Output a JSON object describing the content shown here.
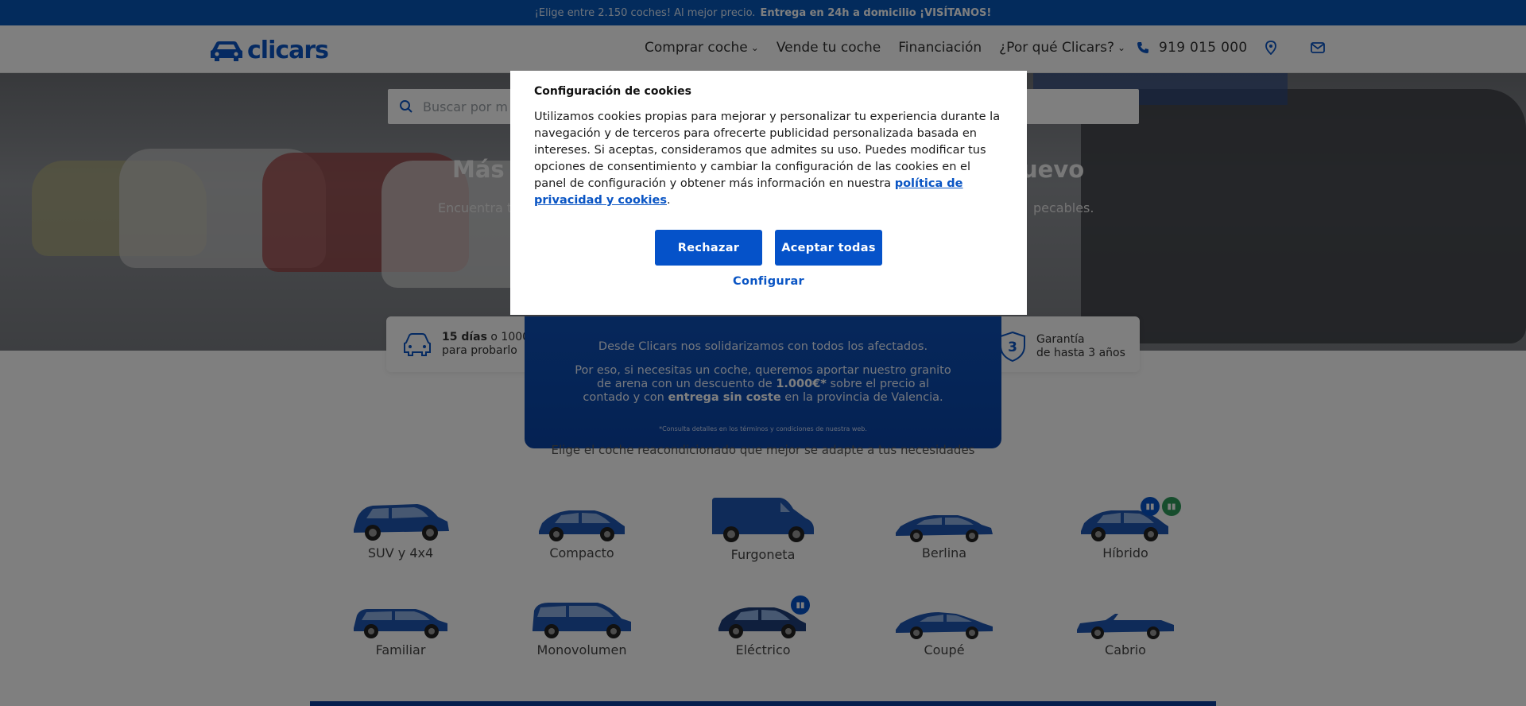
{
  "promo": {
    "text": "¡Elige entre 2.150 coches! Al mejor precio.",
    "highlight": "Entrega en 24h a domicilio ¡VISÍTANOS!"
  },
  "header": {
    "logo_text": "clicars",
    "nav": [
      {
        "label": "Comprar coche",
        "has_dropdown": true
      },
      {
        "label": "Vende tu coche",
        "has_dropdown": false
      },
      {
        "label": "Financiación",
        "has_dropdown": false
      },
      {
        "label": "¿Por qué Clicars?",
        "has_dropdown": true
      }
    ],
    "phone": "919 015 000",
    "icons": [
      "phone-icon",
      "location-pin-icon",
      "mail-icon"
    ]
  },
  "hero": {
    "search_placeholder": "Buscar por m",
    "title_left": "Más g",
    "title_right": "uevo",
    "subtitle_left": "Encuentra t",
    "subtitle_right": "pecables."
  },
  "benefits": [
    {
      "line1_bold": "15 días",
      "line1_rest": " o 1000",
      "line2": "para probarlo",
      "icon": "car-front-icon"
    },
    {
      "line1_bold": "",
      "line1_rest": "Garantía",
      "line2": "de hasta 3 años",
      "icon": "shield-3-icon"
    }
  ],
  "solidarity": {
    "line1": "Desde Clicars nos solidarizamos con todos los afectados.",
    "line2_a": "Por eso, si necesitas un coche, queremos aportar nuestro granito de arena con un descuento de ",
    "line2_bold1": "1.000€*",
    "line2_b": " sobre el precio al contado y con ",
    "line2_bold2": "entrega sin coste",
    "line2_c": " en la provincia de Valencia.",
    "footnote": "*Consulta detalles en los términos y condiciones de nuestra web."
  },
  "section_subtitle": "Elige el coche reacondicionado que mejor se adapte a tus necesidades",
  "categories": [
    {
      "label": "SUV y 4x4"
    },
    {
      "label": "Compacto"
    },
    {
      "label": "Furgoneta"
    },
    {
      "label": "Berlina"
    },
    {
      "label": "Híbrido"
    },
    {
      "label": "Familiar"
    },
    {
      "label": "Monovolumen"
    },
    {
      "label": "Eléctrico"
    },
    {
      "label": "Coupé"
    },
    {
      "label": "Cabrio"
    }
  ],
  "colors": {
    "brand_blue": "#0552c9",
    "promo_blue": "#0757b8",
    "car_blue": "#1f56b3"
  },
  "cookie_modal": {
    "title": "Configuración de cookies",
    "body": "Utilizamos cookies propias para mejorar y personalizar tu experiencia durante la navegación y de terceros para ofrecerte publicidad personalizada basada en intereses. Si aceptas, consideramos que admites su uso. Puedes modificar tus opciones de consentimiento y cambiar la configuración de las cookies en el panel de configuración y obtener más información en nuestra ",
    "link_text": "política de privacidad y cookies",
    "body_end": ".",
    "reject_label": "Rechazar",
    "accept_label": "Aceptar todas",
    "configure_label": "Configurar"
  }
}
